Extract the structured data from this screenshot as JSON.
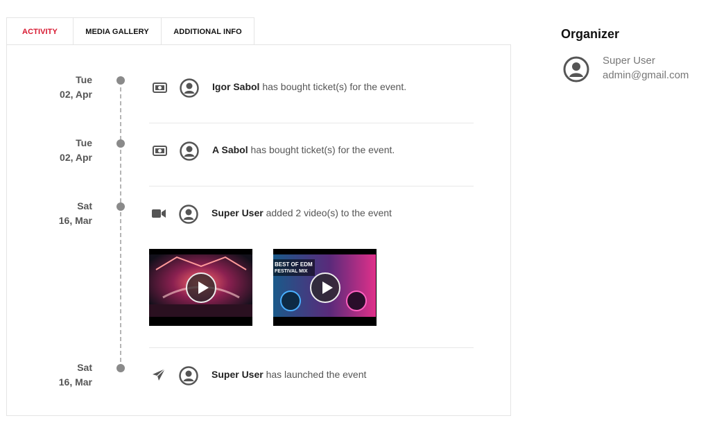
{
  "tabs": [
    {
      "label": "ACTIVITY",
      "active": true
    },
    {
      "label": "MEDIA GALLERY",
      "active": false
    },
    {
      "label": "ADDITIONAL INFO",
      "active": false
    }
  ],
  "activities": [
    {
      "day": "Tue",
      "date": "02, Apr",
      "icon": "money-icon",
      "user": "Igor Sabol",
      "text": " has bought ticket(s) for the event."
    },
    {
      "day": "Tue",
      "date": "02, Apr",
      "icon": "money-icon",
      "user": "A Sabol",
      "text": " has bought ticket(s) for the event."
    },
    {
      "day": "Sat",
      "date": "16, Mar",
      "icon": "video-camera-icon",
      "user": "Super User",
      "text": " added 2 video(s) to the event",
      "videos": [
        {
          "title": "",
          "caption_line1": "",
          "caption_line2": ""
        },
        {
          "title": "",
          "caption_line1": "BEST OF EDM",
          "caption_line2": "FESTIVAL MIX"
        }
      ]
    },
    {
      "day": "Sat",
      "date": "16, Mar",
      "icon": "paper-plane-icon",
      "user": "Super User",
      "text": " has launched the event"
    }
  ],
  "organizer": {
    "heading": "Organizer",
    "name": "Super User",
    "email": "admin@gmail.com"
  },
  "colors": {
    "accent": "#d7172f",
    "dot": "#8a8a8a",
    "text": "#555555"
  }
}
